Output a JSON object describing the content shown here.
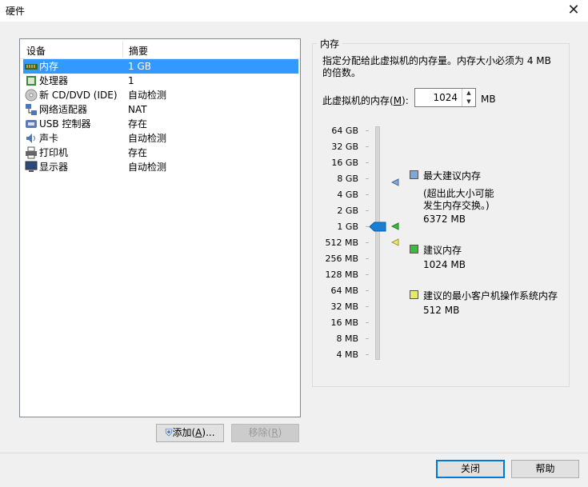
{
  "window": {
    "title": "硬件"
  },
  "device_list": {
    "header": {
      "device": "设备",
      "summary": "摘要"
    },
    "rows": [
      {
        "name": "内存",
        "summary": "1 GB",
        "icon": "memory-icon",
        "selected": true
      },
      {
        "name": "处理器",
        "summary": "1",
        "icon": "cpu-icon"
      },
      {
        "name": "新 CD/DVD (IDE)",
        "summary": "自动检测",
        "icon": "cd-icon"
      },
      {
        "name": "网络适配器",
        "summary": "NAT",
        "icon": "network-icon"
      },
      {
        "name": "USB 控制器",
        "summary": "存在",
        "icon": "usb-icon"
      },
      {
        "name": "声卡",
        "summary": "自动检测",
        "icon": "sound-icon"
      },
      {
        "name": "打印机",
        "summary": "存在",
        "icon": "printer-icon"
      },
      {
        "name": "显示器",
        "summary": "自动检测",
        "icon": "monitor-icon"
      }
    ]
  },
  "buttons": {
    "add": {
      "label": "添加(",
      "mnemonic": "A",
      "suffix": ")..."
    },
    "remove": {
      "label": "移除(",
      "mnemonic": "R",
      "suffix": ")"
    },
    "close": "关闭",
    "help": "帮助"
  },
  "memory": {
    "group_title": "内存",
    "description": "指定分配给此虚拟机的内存量。内存大小必须为 4 MB 的倍数。",
    "field_label": "此虚拟机的内存(",
    "field_mnemonic": "M",
    "field_label_suffix": "):",
    "value": "1024",
    "unit": "MB",
    "scale": [
      "64 GB",
      "32 GB",
      "16 GB",
      "8 GB",
      "4 GB",
      "2 GB",
      "1 GB",
      "512 MB",
      "256 MB",
      "128 MB",
      "64 MB",
      "32 MB",
      "16 MB",
      "8 MB",
      "4 MB"
    ],
    "legend": {
      "max": {
        "title": "最大建议内存",
        "note1": "(超出此大小可能",
        "note2": "发生内存交换。)",
        "value": "6372 MB",
        "color": "#7fa8d8"
      },
      "recommended": {
        "title": "建议内存",
        "value": "1024 MB",
        "color": "#3dbb3d"
      },
      "min": {
        "title": "建议的最小客户机操作系统内存",
        "value": "512 MB",
        "color": "#e8e870"
      }
    }
  },
  "colors": {
    "selection": "#3399ff",
    "slider_thumb": "#1a7fd4"
  }
}
